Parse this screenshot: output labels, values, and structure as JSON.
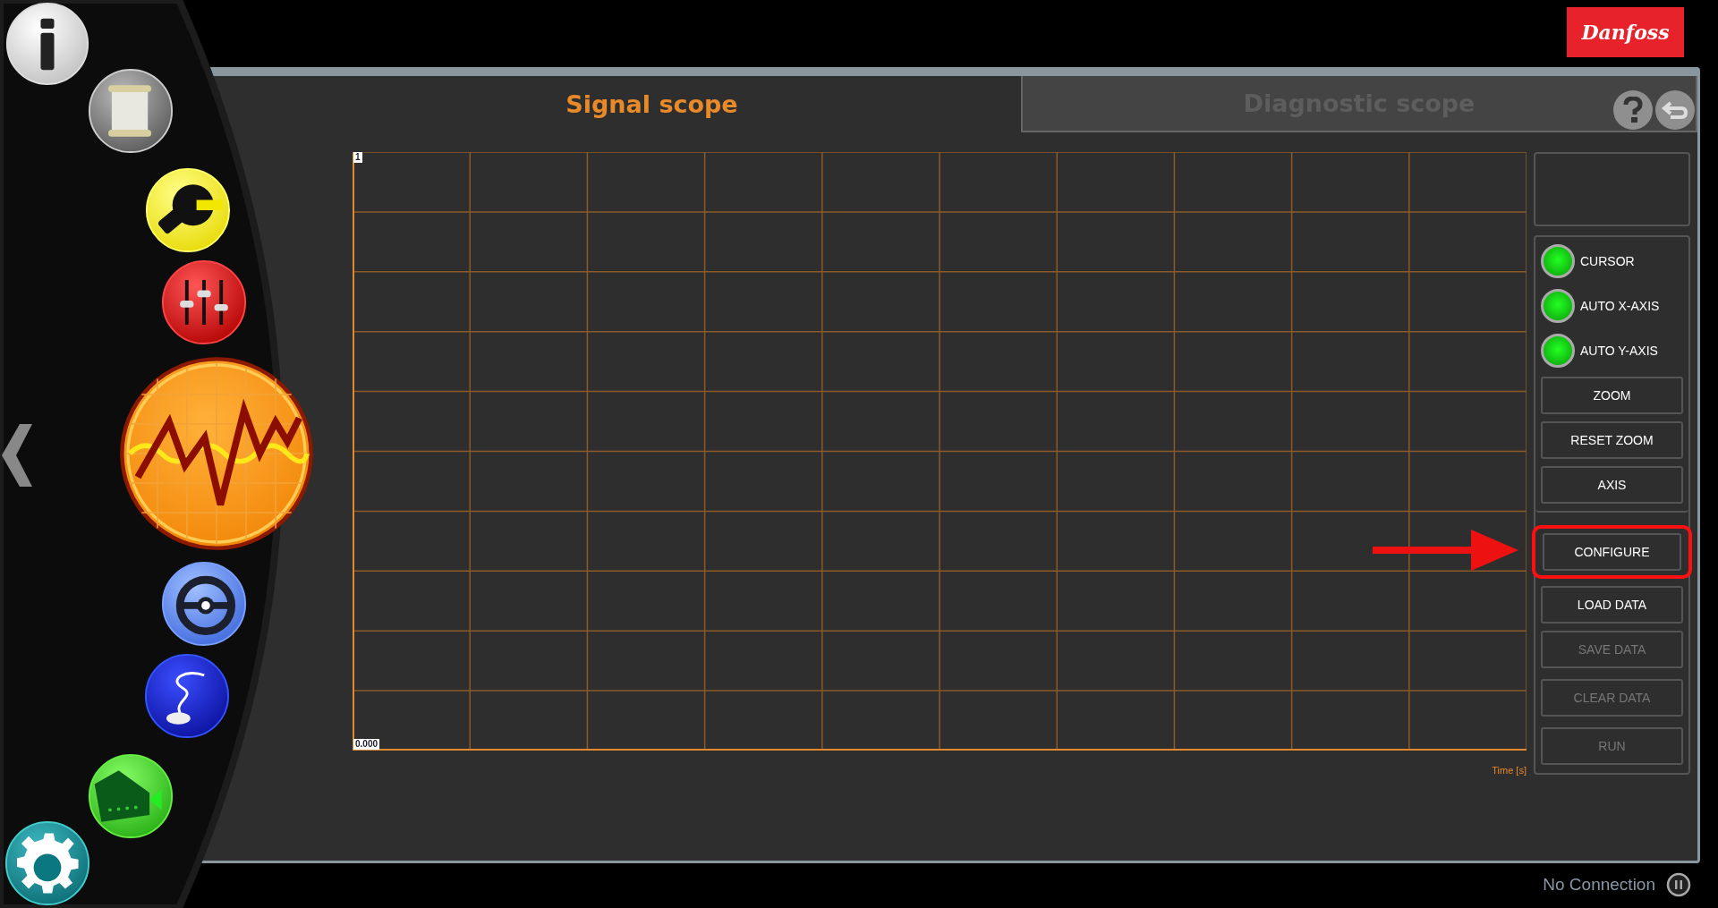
{
  "header": {
    "logo": "Danfoss"
  },
  "sidebar": {
    "items": [
      {
        "selected": false
      },
      {
        "selected": false
      },
      {
        "selected": false
      },
      {
        "selected": false
      },
      {
        "selected": true
      },
      {
        "selected": false
      },
      {
        "selected": false
      },
      {
        "selected": false
      },
      {
        "selected": false
      }
    ]
  },
  "tabs": [
    {
      "label": "Signal scope",
      "selected": true
    },
    {
      "label": "Diagnostic scope",
      "selected": false
    }
  ],
  "chart": {
    "y_top_label": "1",
    "y_bottom_label": "0.000",
    "x_axis_label": "Time [s]"
  },
  "toggles": [
    {
      "label": "CURSOR",
      "on": true
    },
    {
      "label": "AUTO X-AXIS",
      "on": true
    },
    {
      "label": "AUTO Y-AXIS",
      "on": true
    }
  ],
  "view_buttons": [
    {
      "label": "ZOOM"
    },
    {
      "label": "RESET ZOOM"
    },
    {
      "label": "AXIS"
    }
  ],
  "action_buttons": [
    {
      "label": "CONFIGURE",
      "disabled": false,
      "highlighted": true
    },
    {
      "label": "LOAD DATA",
      "disabled": false,
      "highlighted": false
    },
    {
      "label": "SAVE DATA",
      "disabled": true,
      "highlighted": false
    },
    {
      "label": "CLEAR DATA",
      "disabled": true,
      "highlighted": false
    },
    {
      "label": "RUN",
      "disabled": true,
      "highlighted": false
    }
  ],
  "status_bar": {
    "connection": "No Connection"
  }
}
